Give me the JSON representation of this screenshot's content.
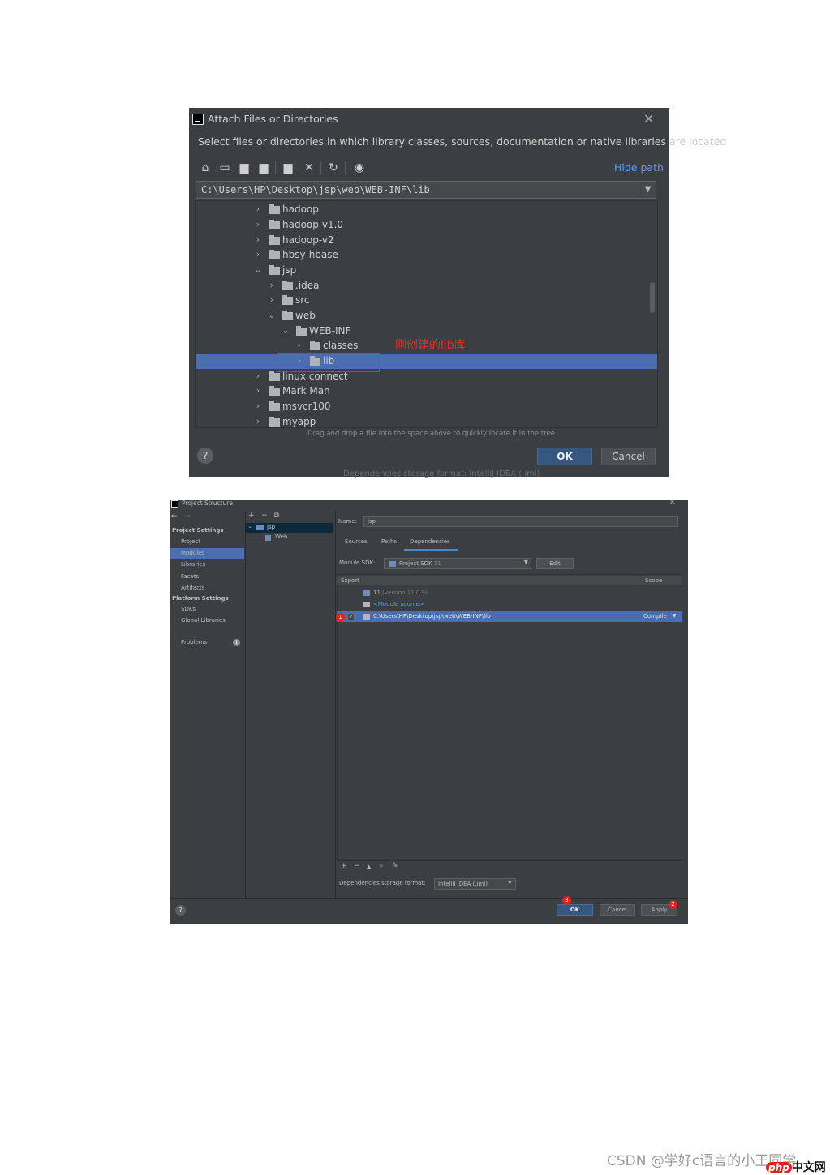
{
  "attach_dialog": {
    "title": "Attach Files or Directories",
    "description": "Select files or directories in which library classes, sources, documentation or native libraries are located",
    "hide_path": "Hide path",
    "path": "C:\\Users\\HP\\Desktop\\jsp\\web\\WEB-INF\\lib",
    "tree": [
      {
        "label": "hadoop",
        "expanded": false
      },
      {
        "label": "hadoop-v1.0",
        "expanded": false
      },
      {
        "label": "hadoop-v2",
        "expanded": false
      },
      {
        "label": "hbsy-hbase",
        "expanded": false
      },
      {
        "label": "jsp",
        "expanded": true
      },
      {
        "label": ".idea",
        "expanded": false
      },
      {
        "label": "src",
        "expanded": false
      },
      {
        "label": "web",
        "expanded": true
      },
      {
        "label": "WEB-INF",
        "expanded": true
      },
      {
        "label": "classes",
        "expanded": false
      },
      {
        "label": "lib",
        "expanded": false,
        "selected": true
      },
      {
        "label": "linux connect",
        "expanded": false
      },
      {
        "label": "Mark Man",
        "expanded": false
      },
      {
        "label": "msvcr100",
        "expanded": false
      },
      {
        "label": "myapp",
        "expanded": false
      }
    ],
    "annotation": "刚创建的lib库",
    "hint": "Drag and drop a file into the space above to quickly locate it in the tree",
    "help": "?",
    "ok": "OK",
    "cancel": "Cancel",
    "bleed_text": "Dependencies storage format:   IntelliJ IDEA (.iml)"
  },
  "project_structure": {
    "title": "Project Structure",
    "left_nav": {
      "project_settings_heading": "Project Settings",
      "project_settings": [
        "Project",
        "Modules",
        "Libraries",
        "Facets",
        "Artifacts"
      ],
      "selected": "Modules",
      "platform_settings_heading": "Platform Settings",
      "platform_settings": [
        "SDKs",
        "Global Libraries"
      ],
      "problems": "Problems",
      "problems_count": "1"
    },
    "modules": {
      "root": "jsp",
      "child": "Web"
    },
    "name_label": "Name:",
    "name_value": "jsp",
    "tabs": [
      "Sources",
      "Paths",
      "Dependencies"
    ],
    "active_tab": "Dependencies",
    "module_sdk_label": "Module SDK:",
    "module_sdk_value": "Project SDK",
    "module_sdk_version": "11",
    "edit_button": "Edit",
    "table": {
      "col_export": "Export",
      "col_scope": "Scope",
      "rows": [
        {
          "label": "11",
          "detail": "(version 11.0.9)"
        },
        {
          "label": "<Module source>"
        },
        {
          "label": "C:\\Users\\HP\\Desktop\\jsp\\web\\WEB-INF\\lib",
          "scope": "Compile",
          "checked": true,
          "selected": true
        }
      ]
    },
    "storage_format_label": "Dependencies storage format:",
    "storage_format_value": "IntelliJ IDEA (.iml)",
    "help": "?",
    "ok": "OK",
    "cancel": "Cancel",
    "apply": "Apply",
    "markers": {
      "checkbox": "1",
      "apply": "2",
      "ok": "3"
    }
  },
  "watermark": {
    "text": "CSDN @学好c语言的小王同学",
    "logo_php": "php",
    "logo_text": "中文网"
  }
}
